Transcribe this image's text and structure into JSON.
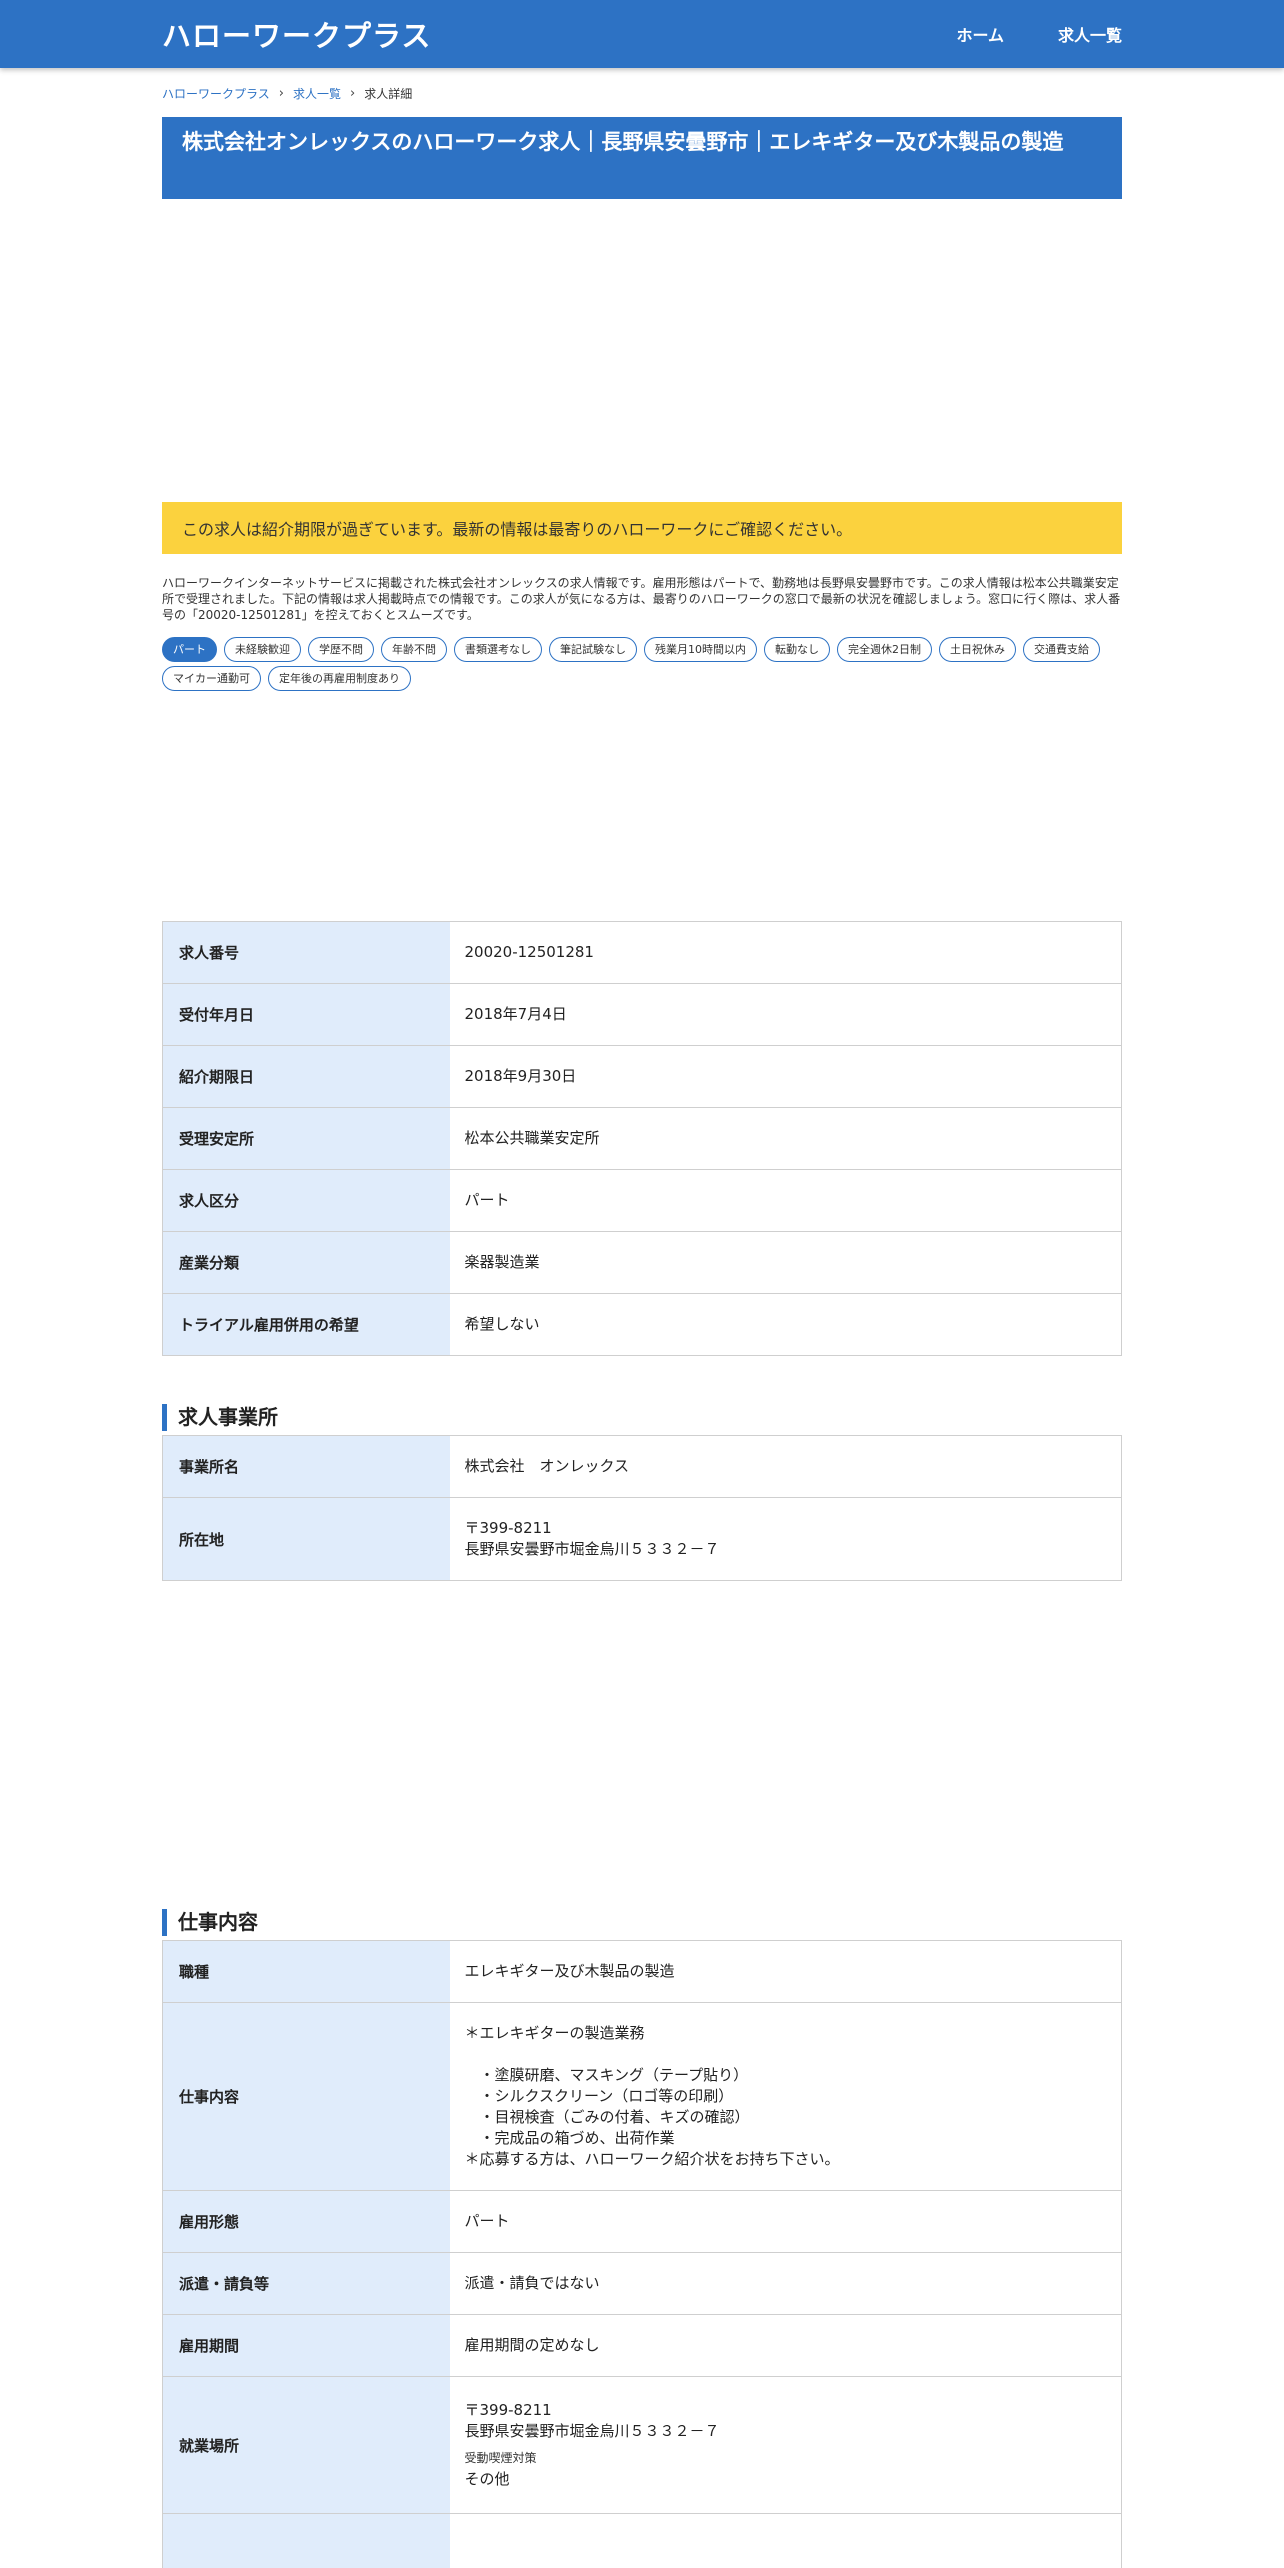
{
  "header": {
    "site_title": "ハローワークプラス",
    "nav": [
      {
        "label": "ホーム"
      },
      {
        "label": "求人一覧"
      }
    ]
  },
  "breadcrumb": {
    "home": "ハローワークプラス",
    "list": "求人一覧",
    "current": "求人詳細"
  },
  "page_title": "株式会社オンレックスのハローワーク求人｜長野県安曇野市｜エレキギター及び木製品の製造",
  "notice": "この求人は紹介期限が過ぎています。最新の情報は最寄りのハローワークにご確認ください。",
  "intro": "ハローワークインターネットサービスに掲載された株式会社オンレックスの求人情報です。雇用形態はパートで、勤務地は長野県安曇野市です。この求人情報は松本公共職業安定所で受理されました。下記の情報は求人掲載時点での情報です。この求人が気になる方は、最寄りのハローワークの窓口で最新の状況を確認しましょう。窓口に行く際は、求人番号の「20020-12501281」を控えておくとスムーズです。",
  "tags": [
    {
      "label": "パート",
      "active": true
    },
    {
      "label": "未経験歓迎"
    },
    {
      "label": "学歴不問"
    },
    {
      "label": "年齢不問"
    },
    {
      "label": "書類選考なし"
    },
    {
      "label": "筆記試験なし"
    },
    {
      "label": "残業月10時間以内"
    },
    {
      "label": "転勤なし"
    },
    {
      "label": "完全週休2日制"
    },
    {
      "label": "土日祝休み"
    },
    {
      "label": "交通費支給"
    },
    {
      "label": "マイカー通勤可"
    },
    {
      "label": "定年後の再雇用制度あり"
    }
  ],
  "basic": [
    {
      "label": "求人番号",
      "value": "20020-12501281"
    },
    {
      "label": "受付年月日",
      "value": "2018年7月4日"
    },
    {
      "label": "紹介期限日",
      "value": "2018年9月30日"
    },
    {
      "label": "受理安定所",
      "value": "松本公共職業安定所"
    },
    {
      "label": "求人区分",
      "value": "パート"
    },
    {
      "label": "産業分類",
      "value": "楽器製造業"
    },
    {
      "label": "トライアル雇用併用の希望",
      "value": "希望しない"
    }
  ],
  "office": {
    "title": "求人事業所",
    "name_label": "事業所名",
    "name_value": "株式会社　オンレックス",
    "address_label": "所在地",
    "postal": "〒399-8211",
    "address": "長野県安曇野市堀金烏川５３３２－７"
  },
  "job": {
    "title": "仕事内容",
    "occupation_label": "職種",
    "occupation_value": "エレキギター及び木製品の製造",
    "content_label": "仕事内容",
    "content_lines": [
      "＊エレキギターの製造業務",
      "",
      "　・塗膜研磨、マスキング（テープ貼り）",
      "　・シルクスクリーン（ロゴ等の印刷）",
      "　・目視検査（ごみの付着、キズの確認）",
      "　・完成品の箱づめ、出荷作業",
      "＊応募する方は、ハローワーク紹介状をお持ち下さい。"
    ],
    "employment_label": "雇用形態",
    "employment_value": "パート",
    "dispatch_label": "派遣・請負等",
    "dispatch_value": "派遣・請負ではない",
    "period_label": "雇用期間",
    "period_value": "雇用期間の定めなし",
    "location_label": "就業場所",
    "location_postal": "〒399-8211",
    "location_address": "長野県安曇野市堀金烏川５３３２－７",
    "smoking_label": "受動喫煙対策",
    "smoking_value": "その他"
  }
}
